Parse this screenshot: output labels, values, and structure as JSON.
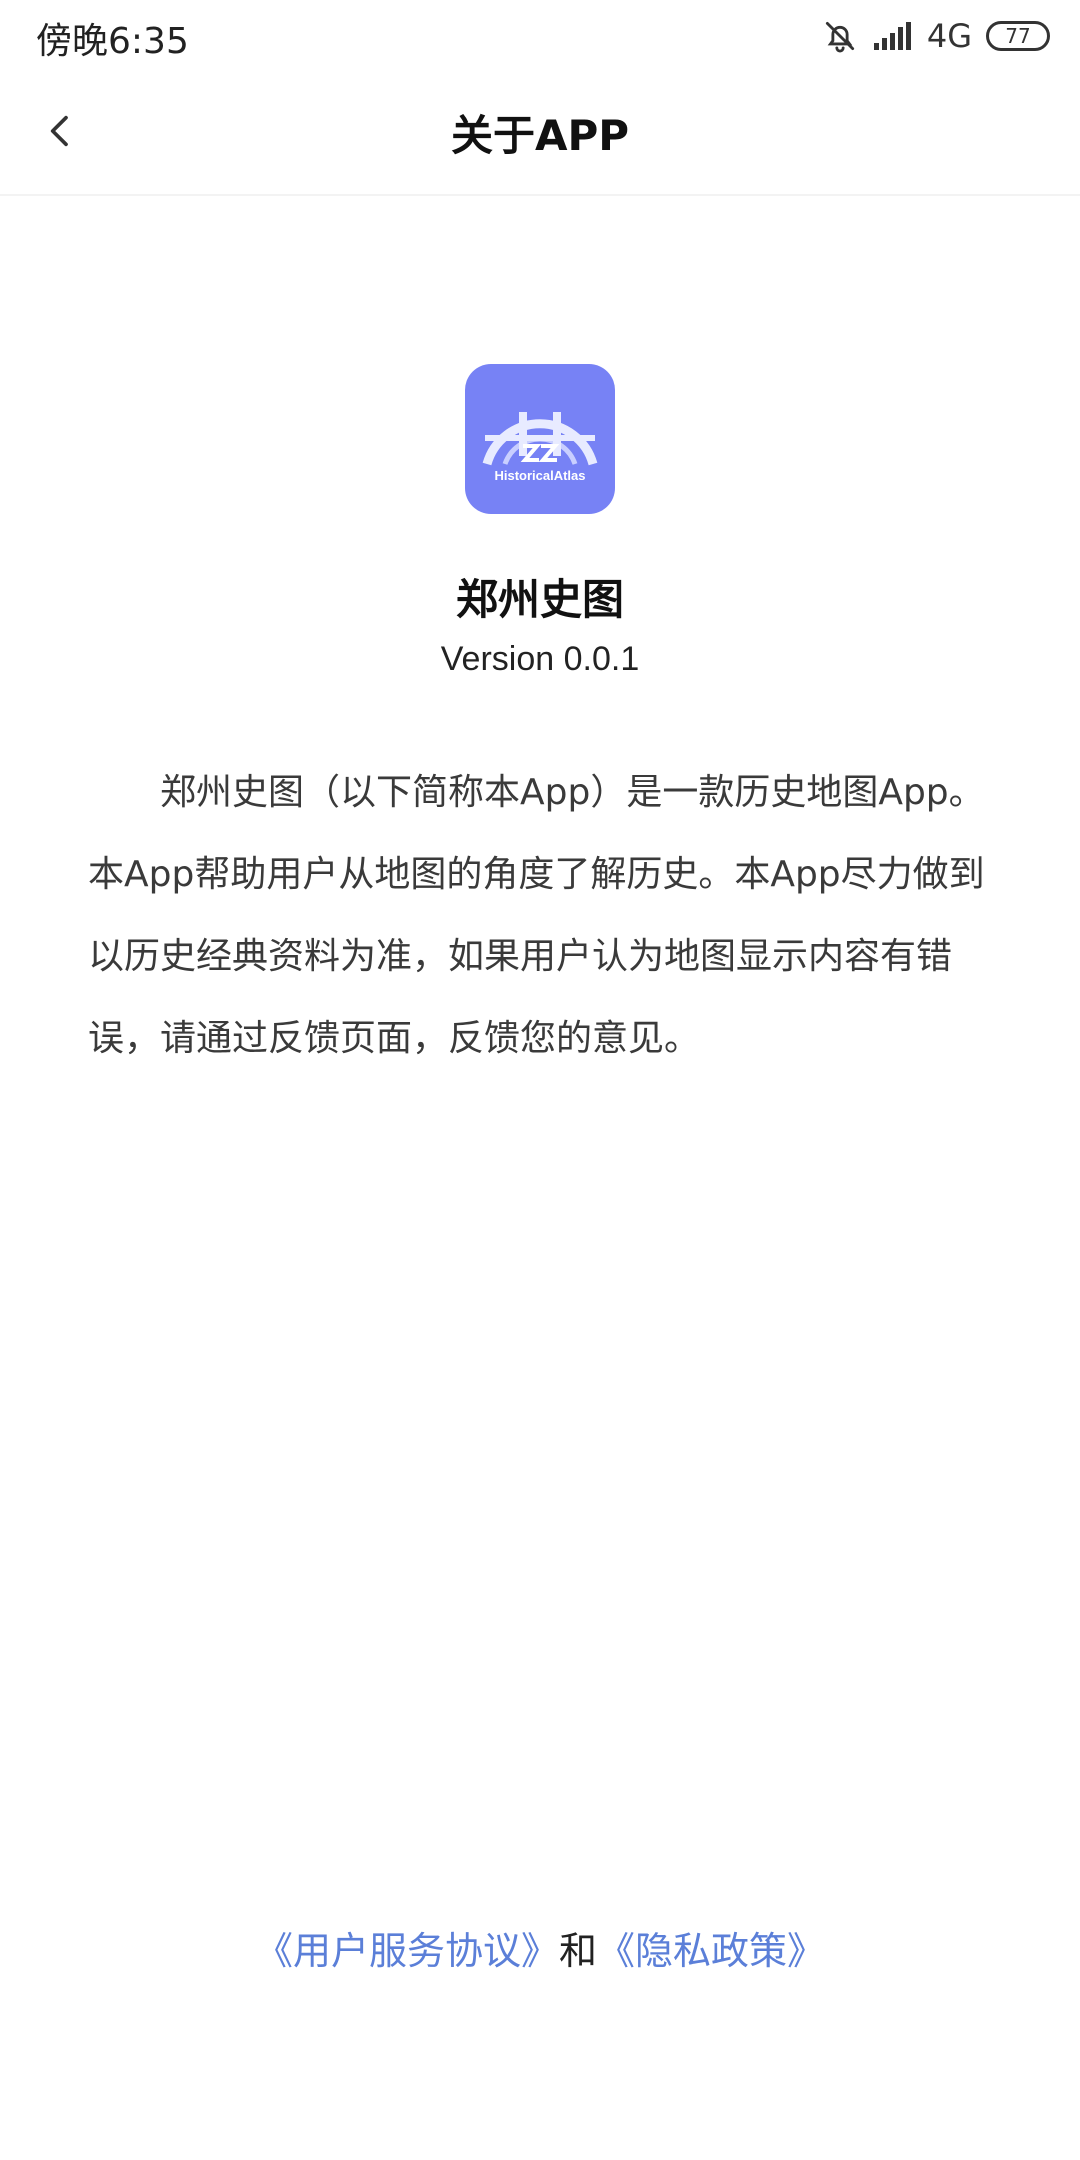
{
  "status_bar": {
    "time": "傍晚6:35",
    "network": "4G",
    "battery": "77",
    "icons": [
      "bell-muted-icon",
      "signal-icon",
      "battery-icon"
    ]
  },
  "header": {
    "title": "关于APP",
    "back_icon": "chevron-left-icon"
  },
  "app": {
    "logo_text": "HistoricalAtlas",
    "logo_color": "#7782f5",
    "name": "郑州史图",
    "version": "Version 0.0.1",
    "description": "郑州史图（以下简称本App）是一款历史地图App。本App帮助用户从地图的角度了解历史。本App尽力做到以历史经典资料为准，如果用户认为地图显示内容有错误，请通过反馈页面，反馈您的意见。"
  },
  "footer": {
    "terms_link": "《用户服务协议》",
    "conjunction": "和",
    "privacy_link": "《隐私政策》",
    "link_color": "#5b7fd8"
  }
}
